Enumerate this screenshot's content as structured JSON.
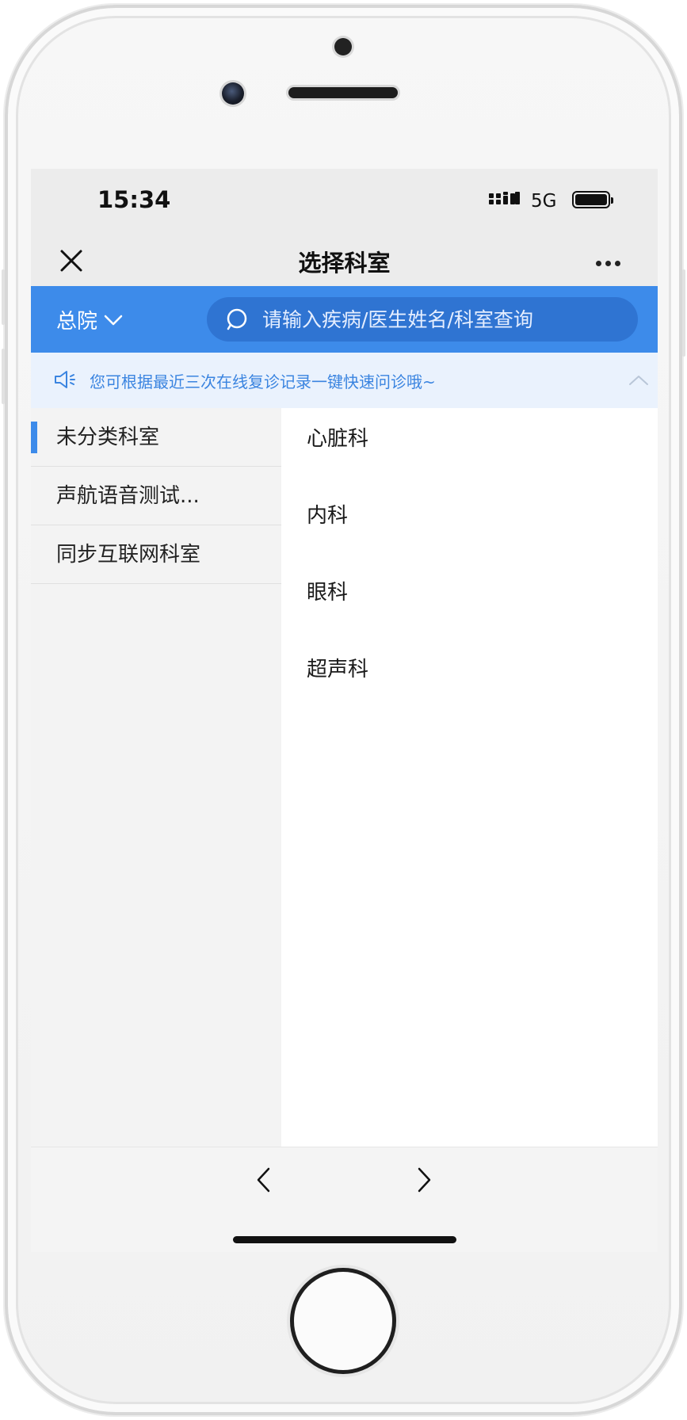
{
  "status_bar": {
    "time": "15:34",
    "network": "5G"
  },
  "nav": {
    "title": "选择科室",
    "close_icon": "close-icon",
    "more_icon": "more-icon"
  },
  "search_bar": {
    "hospital": "总院",
    "placeholder": "请输入疾病/医生姓名/科室查询",
    "accent_color": "#3d8bea"
  },
  "notice": {
    "text": "您可根据最近三次在线复诊记录一键快速问诊哦~"
  },
  "sidebar": {
    "items": [
      {
        "label": "未分类科室",
        "active": true
      },
      {
        "label": "声航语音测试..."
      },
      {
        "label": "同步互联网科室"
      }
    ]
  },
  "departments": [
    {
      "label": "心脏科"
    },
    {
      "label": "内科"
    },
    {
      "label": "眼科"
    },
    {
      "label": "超声科"
    }
  ]
}
